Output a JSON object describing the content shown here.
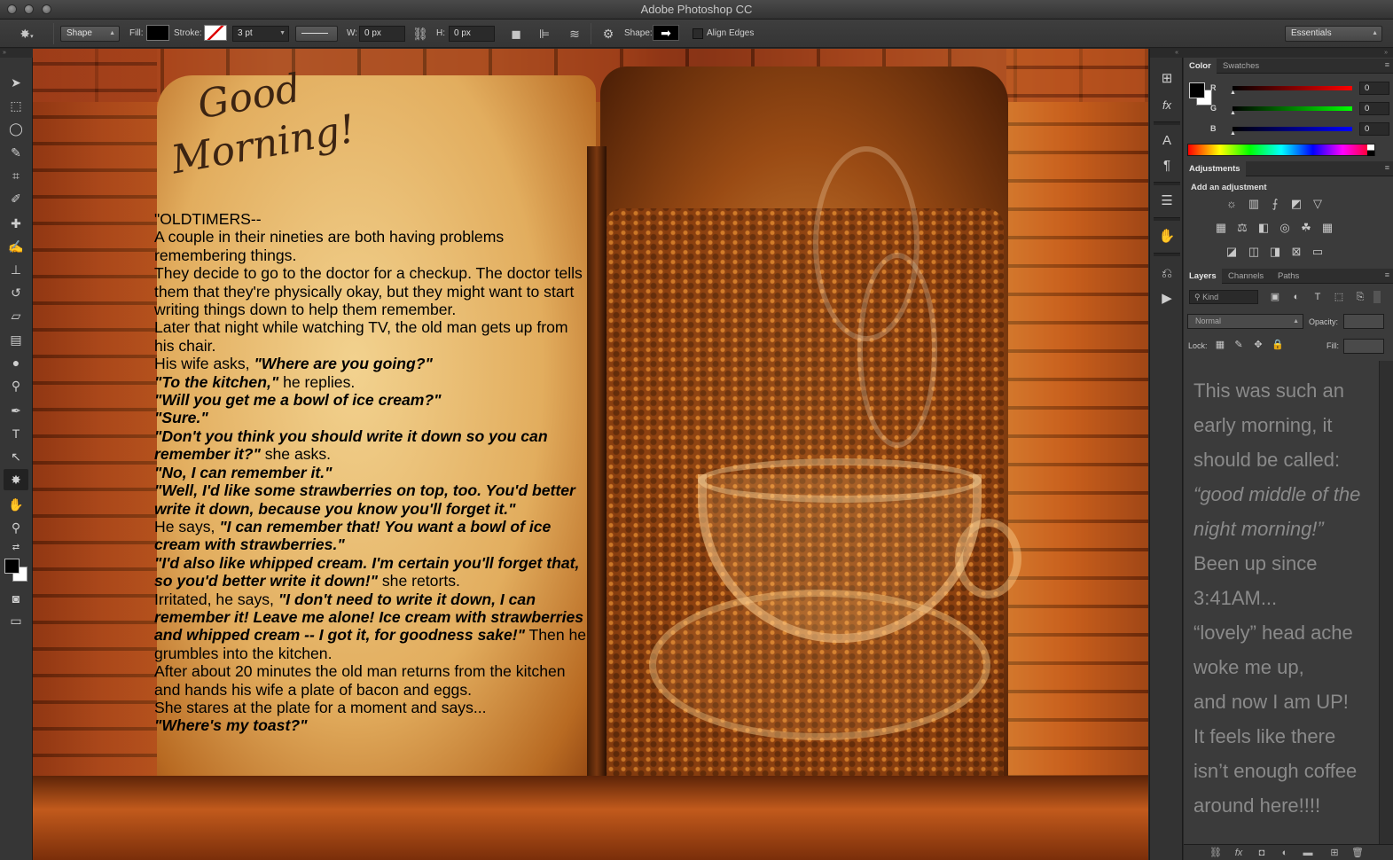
{
  "window": {
    "title": "Adobe Photoshop CC"
  },
  "options_bar": {
    "tool_mode": "Shape",
    "fill_label": "Fill:",
    "stroke_label": "Stroke:",
    "stroke_size": "3 pt",
    "width_label": "W:",
    "width_value": "0 px",
    "height_label": "H:",
    "height_value": "0 px",
    "shape_label": "Shape:",
    "align_edges_label": "Align Edges",
    "workspace": "Essentials",
    "fill_color": "#000000"
  },
  "tools": [
    {
      "name": "move-tool",
      "glyph": "➤"
    },
    {
      "name": "marquee-tool",
      "glyph": "⬚"
    },
    {
      "name": "lasso-tool",
      "glyph": "◯"
    },
    {
      "name": "quick-select-tool",
      "glyph": "✎"
    },
    {
      "name": "crop-tool",
      "glyph": "⌗"
    },
    {
      "name": "eyedropper-tool",
      "glyph": "✐"
    },
    {
      "name": "healing-brush-tool",
      "glyph": "✚"
    },
    {
      "name": "brush-tool",
      "glyph": "✍"
    },
    {
      "name": "clone-stamp-tool",
      "glyph": "⊥"
    },
    {
      "name": "history-brush-tool",
      "glyph": "↺"
    },
    {
      "name": "eraser-tool",
      "glyph": "▱"
    },
    {
      "name": "gradient-tool",
      "glyph": "▤"
    },
    {
      "name": "blur-tool",
      "glyph": "●"
    },
    {
      "name": "dodge-tool",
      "glyph": "⚲"
    },
    {
      "name": "pen-tool",
      "glyph": "✒"
    },
    {
      "name": "type-tool",
      "glyph": "T"
    },
    {
      "name": "path-select-tool",
      "glyph": "↖"
    },
    {
      "name": "custom-shape-tool",
      "glyph": "✸"
    },
    {
      "name": "hand-tool",
      "glyph": "✋"
    },
    {
      "name": "zoom-tool",
      "glyph": "⚲"
    }
  ],
  "canvas": {
    "greeting_line1": "Good",
    "greeting_line2": "Morning!",
    "story": {
      "p1": "\"OLDTIMERS--",
      "p2": "A couple in their nineties are both having problems remembering things.",
      "p3": "They decide to go to the doctor for a checkup. The doctor tells them that they're physically okay, but they might want to start writing things down to help them remember.",
      "p4": "Later that night while watching TV, the old man gets up from his chair.",
      "p5a": "His wife asks, ",
      "p5b": "\"Where are you going?\"",
      "p6a": "\"To the kitchen,\"",
      "p6b": " he replies.",
      "p7": "\"Will you get me a bowl of ice cream?\"",
      "p8": "\"Sure.\"",
      "p9a": "\"Don't you think you should write it down so you can remember it?\"",
      "p9b": " she asks.",
      "p10": "\"No, I can remember it.\"",
      "p11": "\"Well, I'd like some strawberries on top, too. You'd better write it down, because you know you'll forget it.\"",
      "p12a": "He says, ",
      "p12b": "\"I can remember that! You want a bowl of ice cream with strawberries.\"",
      "p13a": "\"I'd also like whipped cream. I'm certain you'll forget that, so you'd better write it down!\"",
      "p13b": " she retorts.",
      "p14a": "Irritated, he says, ",
      "p14b": "\"I don't need to write it down, I can remember it! Leave me alone! Ice cream with strawberries and whipped cream -- I got it, for goodness sake!\"",
      "p14c": " Then he grumbles into the kitchen.",
      "p15": "After about 20 minutes the old man returns from the kitchen and hands his wife a plate of bacon and eggs.",
      "p16": "She stares at the plate for a moment and says...",
      "p17": "\"Where's my toast?\""
    }
  },
  "color_panel": {
    "tab_color": "Color",
    "tab_swatches": "Swatches",
    "r_label": "R",
    "r_value": "0",
    "g_label": "G",
    "g_value": "0",
    "b_label": "B",
    "b_value": "0"
  },
  "adjustments_panel": {
    "tab": "Adjustments",
    "title": "Add an adjustment"
  },
  "layers_panel": {
    "tab_layers": "Layers",
    "tab_channels": "Channels",
    "tab_paths": "Paths",
    "kind": "Kind",
    "blend_mode": "Normal",
    "opacity_label": "Opacity:",
    "lock_label": "Lock:",
    "fill_label": "Fill:",
    "text_line1": "This was such an",
    "text_line2": "early morning, it",
    "text_line3": "should be called:",
    "text_line4": "“good middle of the",
    "text_line5": "night morning!”",
    "text_line6": "Been up since",
    "text_line7": "3:41AM...",
    "text_line8": "“lovely” head ache",
    "text_line9": "woke me up,",
    "text_line10": "and now I am UP!",
    "text_line11": "It feels like there",
    "text_line12": "isn’t enough coffee",
    "text_line13": "around here!!!!"
  }
}
